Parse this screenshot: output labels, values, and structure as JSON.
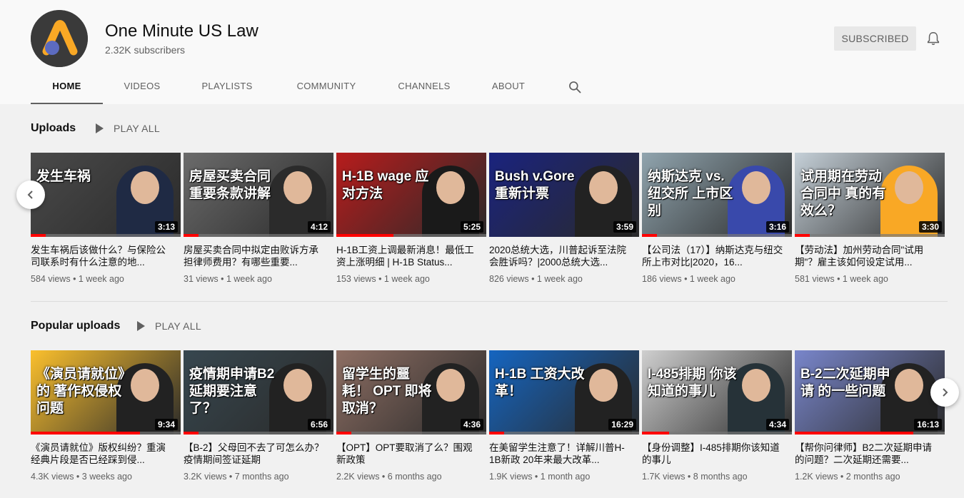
{
  "channel": {
    "name": "One Minute US Law",
    "subscribers": "2.32K subscribers",
    "subscribe_label": "SUBSCRIBED"
  },
  "tabs": [
    {
      "label": "HOME",
      "active": true
    },
    {
      "label": "VIDEOS"
    },
    {
      "label": "PLAYLISTS"
    },
    {
      "label": "COMMUNITY"
    },
    {
      "label": "CHANNELS"
    },
    {
      "label": "ABOUT"
    }
  ],
  "icons": {
    "search": "search-icon",
    "bell": "bell-icon",
    "prev": "chevron-left-icon",
    "next": "chevron-right-icon"
  },
  "colors": {
    "accent": "#ff0000",
    "subscribe_bg": "#e8e8e8"
  },
  "uploads": {
    "title": "Uploads",
    "play_all": "PLAY ALL",
    "videos": [
      {
        "caption": "发生车祸",
        "duration": "3:13",
        "progress": 0.1,
        "title": "发生车祸后该做什么？与保险公司联系时有什么注意的地...",
        "views": "584 views",
        "age": "1 week ago",
        "bg": "#4a4a4a",
        "person": "#1f2a44"
      },
      {
        "caption": "房屋买卖合同 重要条款讲解",
        "duration": "4:12",
        "progress": 0.1,
        "title": "房屋买卖合同中拟定由败诉方承担律师费用？有哪些重要...",
        "views": "31 views",
        "age": "1 week ago",
        "bg": "#6b6b6b",
        "person": "#2b2b2b"
      },
      {
        "caption": "H-1B wage 应对方法",
        "duration": "5:25",
        "progress": 0.38,
        "title": "H-1B工资上调最新消息！最低工资上涨明细 | H-1B Status...",
        "views": "153 views",
        "age": "1 week ago",
        "bg": "#b71c1c",
        "person": "#1a1a1a"
      },
      {
        "caption": "Bush v.Gore 重新计票",
        "duration": "3:59",
        "progress": 0.0,
        "title": "2020总统大选，川普起诉至法院会胜诉吗？|2000总统大选...",
        "views": "826 views",
        "age": "1 week ago",
        "bg": "#1a237e",
        "person": "#222222"
      },
      {
        "caption": "纳斯达克 vs. 纽交所 上市区别",
        "duration": "3:16",
        "progress": 0.1,
        "title": "【公司法（17）】纳斯达克与纽交所上市对比|2020，16...",
        "views": "186 views",
        "age": "1 week ago",
        "bg": "#90a4ae",
        "person": "#3949ab"
      },
      {
        "caption": "试用期在劳动合同中 真的有效么？",
        "duration": "3:30",
        "progress": 0.1,
        "title": "【劳动法】加州劳动合同\"试用期\"？雇主该如何设定试用...",
        "views": "581 views",
        "age": "1 week ago",
        "bg": "#c5d0d8",
        "person": "#f9a825"
      }
    ]
  },
  "popular": {
    "title": "Popular uploads",
    "play_all": "PLAY ALL",
    "videos": [
      {
        "caption": "《演员请就位》的 著作权侵权问题",
        "duration": "9:34",
        "progress": 0.73,
        "title": "《演员请就位》版权纠纷？重演经典片段是否已经踩到侵...",
        "views": "4.3K views",
        "age": "3 weeks ago",
        "bg": "#fbc02d",
        "person": "#222222"
      },
      {
        "caption": "疫情期申请B2 延期要注意了？",
        "duration": "6:56",
        "progress": 0.1,
        "title": "【B-2】父母回不去了可怎么办？疫情期间签证延期",
        "views": "3.2K views",
        "age": "7 months ago",
        "bg": "#37474f",
        "person": "#222222"
      },
      {
        "caption": "留学生的噩耗！ OPT 即将取消？",
        "duration": "4:36",
        "progress": 0.1,
        "title": "【OPT】OPT要取消了么？围观新政策",
        "views": "2.2K views",
        "age": "6 months ago",
        "bg": "#8d6e63",
        "person": "#222222"
      },
      {
        "caption": "H-1B 工资大改革！",
        "duration": "16:29",
        "progress": 0.1,
        "title": "在美留学生注意了！详解川普H-1B新政 20年来最大改革...",
        "views": "1.9K views",
        "age": "1 month ago",
        "bg": "#1565c0",
        "person": "#222222"
      },
      {
        "caption": "I-485排期 你该知道的事儿",
        "duration": "4:34",
        "progress": 0.18,
        "title": "【身份调整】I-485排期你该知道的事儿",
        "views": "1.7K views",
        "age": "8 months ago",
        "bg": "#cfcfcf",
        "person": "#263238"
      },
      {
        "caption": "B-2二次延期申请 的一些问题",
        "duration": "16:13",
        "progress": 0.79,
        "title": "【帮你问律师】B2二次延期申请的问题？二次延期还需要...",
        "views": "1.2K views",
        "age": "2 months ago",
        "bg": "#7986cb",
        "person": "#222222"
      }
    ]
  }
}
